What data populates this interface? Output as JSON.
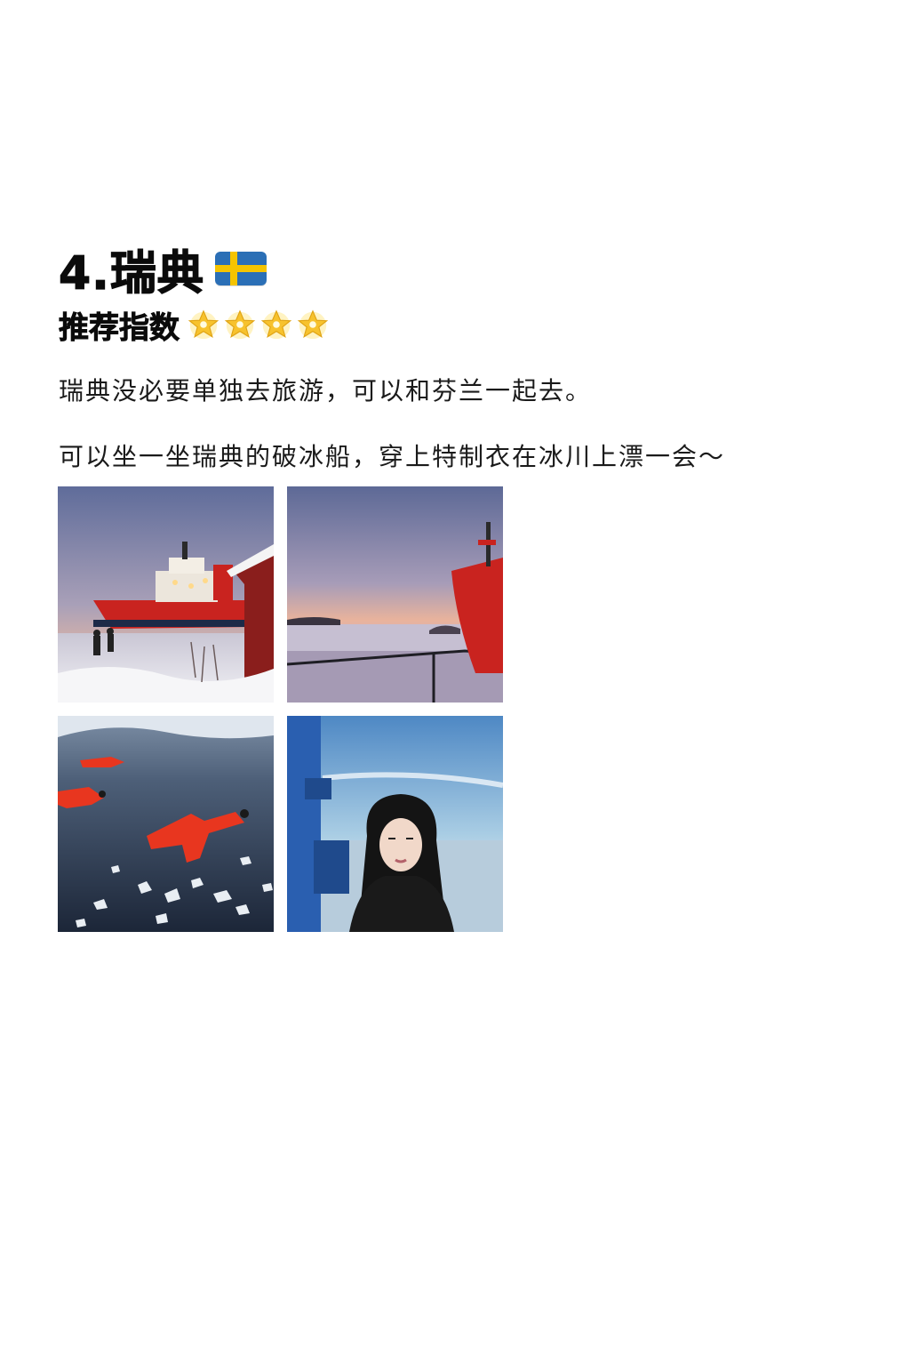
{
  "heading": {
    "title": "4.瑞典",
    "flag_icon": "sweden-flag-icon",
    "flag_colors": {
      "blue": "#2b6fb6",
      "yellow": "#f5c400"
    }
  },
  "rating": {
    "label": "推荐指数",
    "stars": 4,
    "star_icon": "glowing-star-icon",
    "star_color": "#f7c22d"
  },
  "paragraphs": [
    "瑞典没必要单独去旅游，可以和芬兰一起去。",
    "可以坐一坐瑞典的破冰船，穿上特制衣在冰川上漂一会～"
  ],
  "photos": [
    {
      "id": "icebreaker-ship-dusk"
    },
    {
      "id": "icebreaker-bow-sunset"
    },
    {
      "id": "floating-survival-suits"
    },
    {
      "id": "woman-portrait-on-deck"
    }
  ]
}
